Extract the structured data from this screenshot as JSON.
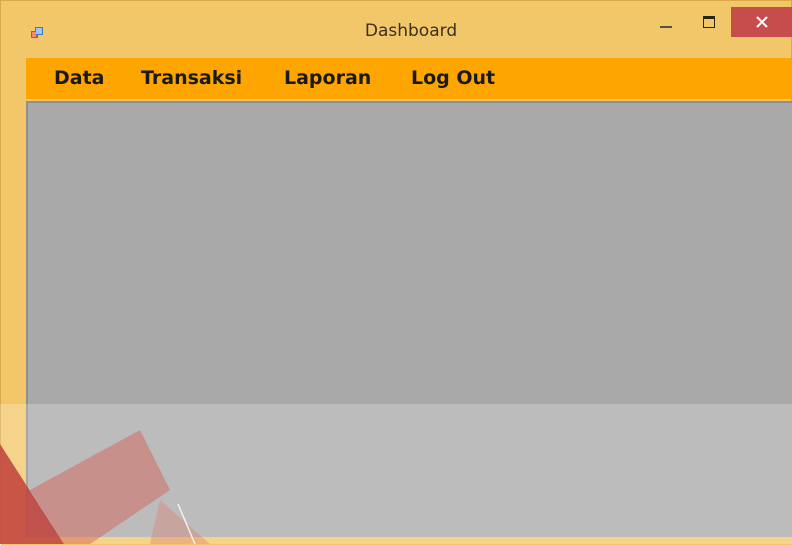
{
  "window": {
    "title": "Dashboard",
    "close_symbol": "✕"
  },
  "menu": {
    "items": [
      {
        "label": "Data"
      },
      {
        "label": "Transaksi"
      },
      {
        "label": "Laporan"
      },
      {
        "label": "Log Out"
      }
    ]
  },
  "colors": {
    "title_bar": "#f2c76a",
    "menu_bar": "#ffa500",
    "client_area": "#a9a9a9",
    "close_button": "#c74d4d"
  },
  "icons": {
    "app": "app-form-icon",
    "minimize": "minimize-icon",
    "maximize": "maximize-icon",
    "close": "close-icon"
  }
}
